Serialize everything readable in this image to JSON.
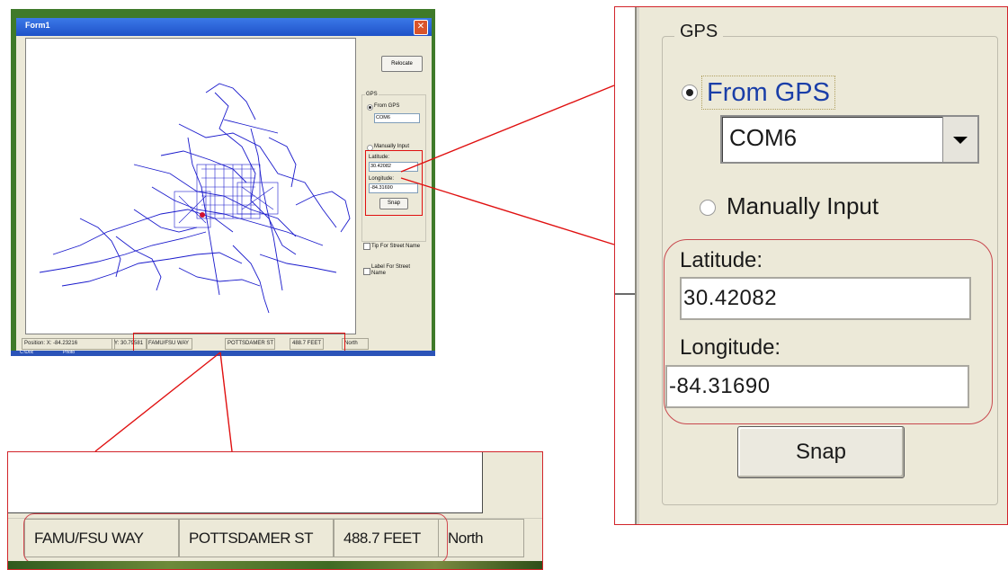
{
  "window": {
    "title": "Form1",
    "close_glyph": "✕"
  },
  "toolbar": {
    "relocate_label": "Relocate"
  },
  "gps": {
    "group_label": "GPS",
    "from_gps_label": "From GPS",
    "port_value": "COM6",
    "manual_label": "Manually Input",
    "latitude_label": "Latitude:",
    "latitude_value": "30.42082",
    "longitude_label": "Longitude:",
    "longitude_value": "-84.31690",
    "snap_label": "Snap",
    "selected_mode": "From GPS"
  },
  "mini_gps": {
    "latitude_label": "Latitude:",
    "longitude_label": "Longitude:"
  },
  "options": {
    "tip_label": "Tip For Street Name",
    "label_label": "Label For Street Name"
  },
  "status": {
    "position_label": "Position:",
    "x": "X: -84.23216",
    "y": "Y: 30.79581",
    "street1": "FAMU/FSU WAY",
    "street2": "POTTSDAMER ST",
    "distance": "488.7 FEET",
    "direction": "North"
  },
  "taskbar": {
    "items": [
      "C:\\Doc",
      "Photo"
    ]
  },
  "colors": {
    "map_roads": "#1a1acc",
    "highlight": "#e01010",
    "current_position": "#d01030",
    "titlebar": "#2a5fd8"
  }
}
